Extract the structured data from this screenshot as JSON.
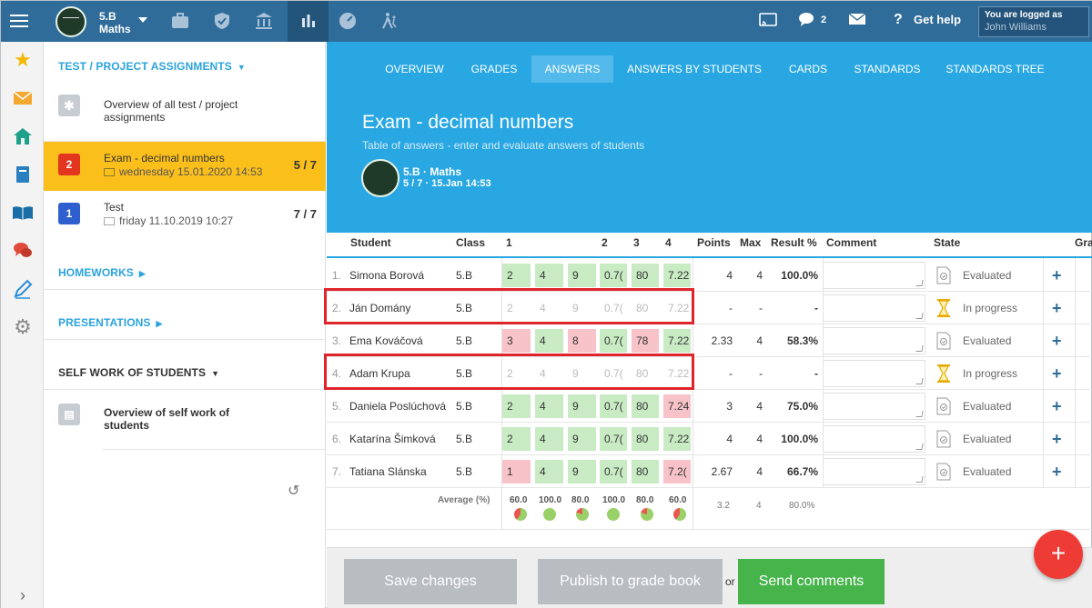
{
  "topbar": {
    "class_name": "5.B",
    "subject": "Maths",
    "messages_count": "2",
    "help_label": "Get help",
    "logged_label": "You are logged as",
    "user_name": "John Williams"
  },
  "panel": {
    "assignments_header": "TEST / PROJECT ASSIGNMENTS",
    "overview_all": "Overview of all test / project assignments",
    "items": [
      {
        "badge": "2",
        "title": "Exam - decimal numbers",
        "date": "wednesday 15.01.2020 14:53",
        "count": "5 / 7"
      },
      {
        "badge": "1",
        "title": "Test",
        "date": "friday 11.10.2019 10:27",
        "count": "7 / 7"
      }
    ],
    "homeworks": "HOMEWORKS",
    "presentations": "PRESENTATIONS",
    "self_work": "SELF WORK OF STUDENTS",
    "overview_self": "Overview of self work of students"
  },
  "tabs": [
    "OVERVIEW",
    "GRADES",
    "ANSWERS",
    "ANSWERS BY STUDENTS",
    "CARDS",
    "STANDARDS",
    "STANDARDS TREE"
  ],
  "hero": {
    "title": "Exam - decimal numbers",
    "subtitle": "Table of answers - enter and evaluate answers of students",
    "class": "5.B · Maths",
    "meta": "5 / 7 · 15.Jan 14:53"
  },
  "table": {
    "headers": {
      "student": "Student",
      "class": "Class",
      "q1": "1",
      "q2": "2",
      "q3": "3",
      "q4": "4",
      "points": "Points",
      "max": "Max",
      "result": "Result %",
      "comment": "Comment",
      "state": "State",
      "grade": "Gra"
    },
    "rows": [
      {
        "idx": "1.",
        "name": "Simona Borová",
        "class": "5.B",
        "answers": [
          "2",
          "4",
          "9",
          "0.7(",
          "80",
          "7.22"
        ],
        "colors": [
          "g",
          "g",
          "g",
          "g",
          "g",
          "g"
        ],
        "points": "4",
        "max": "4",
        "result": "100.0%",
        "state": "Evaluated"
      },
      {
        "idx": "2.",
        "name": "Ján Domány",
        "class": "5.B",
        "answers": [
          "2",
          "4",
          "9",
          "0.7(",
          "80",
          "7.22"
        ],
        "colors": [
          "e",
          "e",
          "e",
          "e",
          "e",
          "e"
        ],
        "points": "-",
        "max": "-",
        "result": "-",
        "state": "In progress"
      },
      {
        "idx": "3.",
        "name": "Ema Kováčová",
        "class": "5.B",
        "answers": [
          "3",
          "4",
          "8",
          "0.7(",
          "78",
          "7.22"
        ],
        "colors": [
          "r",
          "g",
          "r",
          "g",
          "r",
          "g"
        ],
        "points": "2.33",
        "max": "4",
        "result": "58.3%",
        "state": "Evaluated"
      },
      {
        "idx": "4.",
        "name": "Adam Krupa",
        "class": "5.B",
        "answers": [
          "2",
          "4",
          "9",
          "0.7(",
          "80",
          "7.22"
        ],
        "colors": [
          "e",
          "e",
          "e",
          "e",
          "e",
          "e"
        ],
        "points": "-",
        "max": "-",
        "result": "-",
        "state": "In progress"
      },
      {
        "idx": "5.",
        "name": "Daniela Poslúchová",
        "class": "5.B",
        "answers": [
          "2",
          "4",
          "9",
          "0.7(",
          "80",
          "7.24"
        ],
        "colors": [
          "g",
          "g",
          "g",
          "g",
          "g",
          "r"
        ],
        "points": "3",
        "max": "4",
        "result": "75.0%",
        "state": "Evaluated"
      },
      {
        "idx": "6.",
        "name": "Katarína Šimková",
        "class": "5.B",
        "answers": [
          "2",
          "4",
          "9",
          "0.7(",
          "80",
          "7.22"
        ],
        "colors": [
          "g",
          "g",
          "g",
          "g",
          "g",
          "g"
        ],
        "points": "4",
        "max": "4",
        "result": "100.0%",
        "state": "Evaluated"
      },
      {
        "idx": "7.",
        "name": "Tatiana Slánska",
        "class": "5.B",
        "answers": [
          "1",
          "4",
          "9",
          "0.7(",
          "80",
          "7.2("
        ],
        "colors": [
          "r",
          "g",
          "g",
          "g",
          "g",
          "r"
        ],
        "points": "2.67",
        "max": "4",
        "result": "66.7%",
        "state": "Evaluated"
      }
    ],
    "average": {
      "label": "Average (%)",
      "values": [
        "60.0",
        "100.0",
        "80.0",
        "100.0",
        "80.0",
        "60.0"
      ],
      "fractions": [
        0.6,
        1.0,
        0.8,
        1.0,
        0.8,
        0.6
      ],
      "points": "3.2",
      "max": "4",
      "result": "80.0%"
    }
  },
  "buttons": {
    "save": "Save changes",
    "publish": "Publish to grade book",
    "or": "or",
    "send": "Send comments",
    "fab": "+"
  }
}
